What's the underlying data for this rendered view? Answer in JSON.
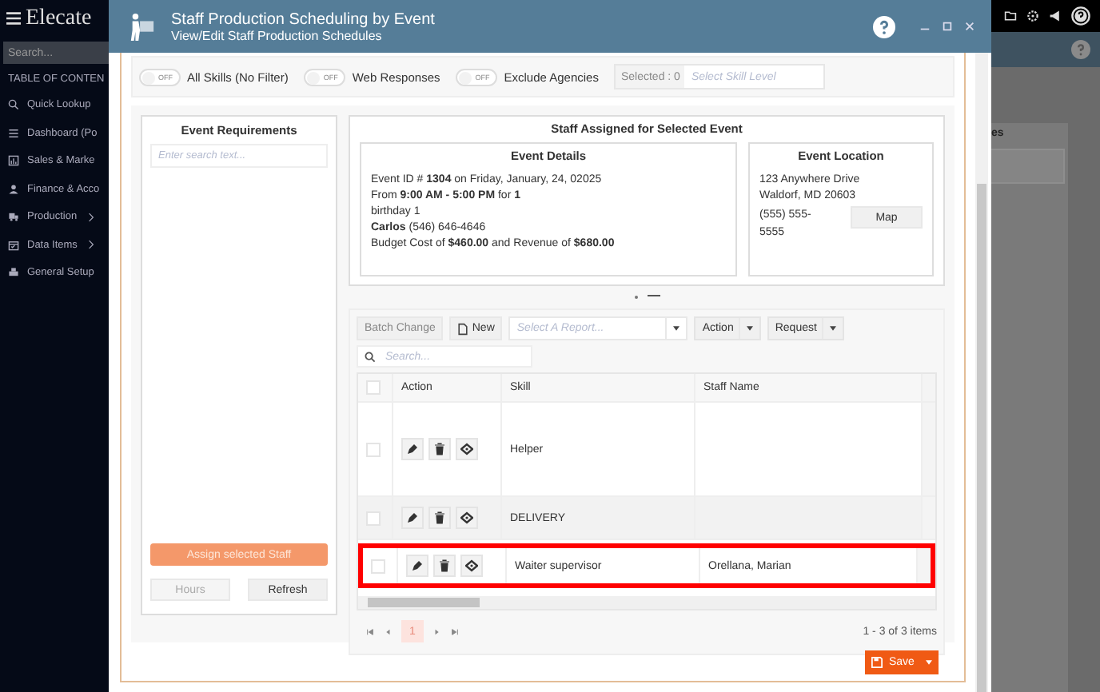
{
  "app": {
    "brand": "Elecate",
    "search_placeholder": "Search...",
    "toc_title": "TABLE OF CONTEN",
    "nav": [
      {
        "label": "Quick Lookup",
        "kind": "search"
      },
      {
        "label": "Dashboard (Po",
        "kind": "list"
      },
      {
        "label": "Sales & Marke",
        "kind": "chart"
      },
      {
        "label": "Finance & Acco",
        "kind": "people"
      },
      {
        "label": "Production",
        "kind": "truck",
        "has_submenu": true
      },
      {
        "label": "Data Items",
        "kind": "calendar",
        "has_submenu": true
      },
      {
        "label": "General Setup",
        "kind": "printer"
      }
    ],
    "background_panel": {
      "heading": "es"
    }
  },
  "dialog": {
    "title": "Staff Production Scheduling by Event",
    "subtitle": "View/Edit Staff Production Schedules"
  },
  "filters": {
    "toggles": [
      {
        "label": "All Skills (No Filter)",
        "on": false,
        "state_text": "OFF"
      },
      {
        "label": "Web Responses",
        "on": false,
        "state_text": "OFF"
      },
      {
        "label": "Exclude Agencies",
        "on": false,
        "state_text": "OFF"
      }
    ],
    "selected_count": "Selected : 0",
    "skill_level_placeholder": "Select Skill Level"
  },
  "requirements": {
    "title": "Event Requirements",
    "search_placeholder": "Enter search text...",
    "assign_button": "Assign selected Staff",
    "hours_button": "Hours",
    "hours_disabled": true,
    "refresh_button": "Refresh"
  },
  "assigned": {
    "title": "Staff Assigned for Selected Event",
    "details": {
      "title": "Event Details",
      "lines": [
        "Event ID # **1304** on Friday, January, 24, 02025",
        "From **9:00 AM - 5:00 PM** for **1**",
        "birthday 1",
        "**Carlos** (546) 646-4646",
        "Budget Cost of **$460.00** and Revenue of **$680.00**"
      ]
    },
    "location": {
      "title": "Event Location",
      "lines": [
        "123 Anywhere Drive",
        "Waldorf, MD 20603"
      ],
      "phone": "(555) 555-5555",
      "map_button": "Map"
    }
  },
  "grid": {
    "batch_button": "Batch Change",
    "new_button": "New",
    "report_placeholder": "Select A Report...",
    "action_button": "Action",
    "request_button": "Request",
    "search_placeholder": "Search...",
    "select_all_checked": false,
    "columns": [
      "Action",
      "Skill",
      "Staff Name"
    ],
    "rows": [
      {
        "skill": "Helper",
        "checked": false,
        "highlighted": false
      },
      {
        "skill": "DELIVERY",
        "checked": false,
        "highlighted": false
      },
      {
        "skill": "Waiter supervisor",
        "staff": "Orellana, Marian",
        "checked": false,
        "highlighted": true
      }
    ],
    "pager": {
      "pages": [
        {
          "label": "1",
          "selected": true
        }
      ],
      "summary": "1 - 3 of 3 items"
    }
  },
  "save_button": "Save"
}
